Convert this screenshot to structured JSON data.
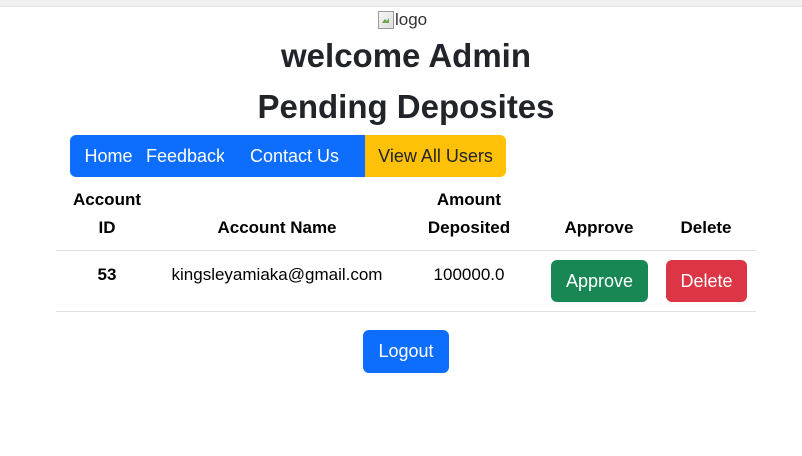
{
  "logo": {
    "alt_text": "logo"
  },
  "header": {
    "welcome": "welcome Admin",
    "page_title": "Pending Deposites"
  },
  "nav": {
    "items": [
      {
        "label": "Home"
      },
      {
        "label": "Feedback"
      },
      {
        "label": "Contact Us"
      },
      {
        "label": "View All Users"
      }
    ]
  },
  "table": {
    "headers": {
      "account_id_line1": "Account",
      "account_id_line2": "ID",
      "account_name": "Account Name",
      "amount_line1": "Amount",
      "amount_line2": "Deposited",
      "approve": "Approve",
      "delete": "Delete"
    },
    "rows": [
      {
        "account_id": "53",
        "account_name": "kingsleyamiaka@gmail.com",
        "amount": "100000.0",
        "approve_label": "Approve",
        "delete_label": "Delete"
      }
    ]
  },
  "logout_label": "Logout",
  "colors": {
    "primary": "#0d6efd",
    "warning": "#ffc107",
    "success": "#198754",
    "danger": "#dc3545"
  }
}
